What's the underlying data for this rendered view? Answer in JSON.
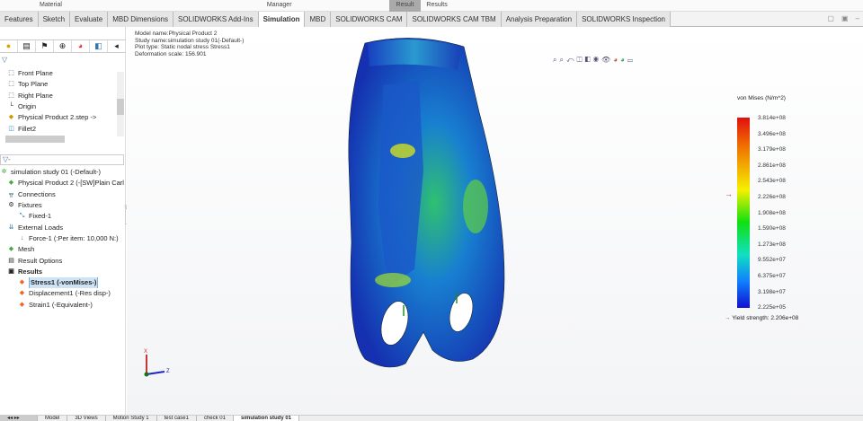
{
  "top_strip": {
    "labels": [
      "Material",
      "Manager",
      "Result",
      "Results"
    ]
  },
  "tabs": [
    "Features",
    "Sketch",
    "Evaluate",
    "MBD Dimensions",
    "SOLIDWORKS Add-Ins",
    "Simulation",
    "MBD",
    "SOLIDWORKS CAM",
    "SOLIDWORKS CAM TBM",
    "Analysis Preparation",
    "SOLIDWORKS Inspection"
  ],
  "active_tab": "Simulation",
  "feature_tree": [
    "Front Plane",
    "Top Plane",
    "Right Plane",
    "Origin",
    "Physical Product 2.step ->",
    "Fillet2"
  ],
  "sim_tree": {
    "study": "simulation study 01 (-Default-)",
    "items": [
      "Physical Product 2 (-[SW]Plain Carl",
      "Connections",
      "Fixtures",
      "Fixed-1",
      "External Loads",
      "Force-1 (:Per item: 10,000 N:)",
      "Mesh",
      "Result Options",
      "Results",
      "Stress1 (-vonMises-)",
      "Displacement1 (-Res disp-)",
      "Strain1 (-Equivalent-)"
    ]
  },
  "plot_info": [
    "Model name:Physical Product 2",
    "Study name:simulation study 01(-Default-)",
    "Plot type: Static nodal stress Stress1",
    "Deformation scale: 156.901"
  ],
  "legend": {
    "title": "von Mises (N/m^2)",
    "ticks": [
      "3.814e+08",
      "3.496e+08",
      "3.179e+08",
      "2.861e+08",
      "2.543e+08",
      "2.226e+08",
      "1.908e+08",
      "1.590e+08",
      "1.273e+08",
      "9.552e+07",
      "6.375e+07",
      "3.198e+07",
      "2.225e+05"
    ],
    "yield": "Yield strength: 2.206e+08"
  },
  "triad": {
    "x": "X",
    "z": "Z"
  },
  "bottom_tabs": [
    "Model",
    "3D Views",
    "Motion Study 1",
    "test case1",
    "check 01",
    "simulation study 01"
  ],
  "colors": {
    "selection": "#cde4f7",
    "yield_arrow": "#d22222"
  }
}
